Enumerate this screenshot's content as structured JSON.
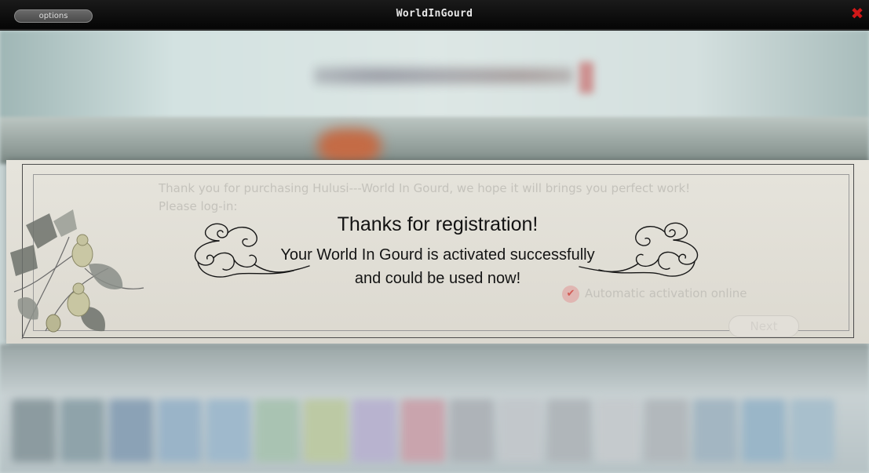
{
  "window": {
    "title": "WorldInGourd",
    "options_label": "options",
    "close_glyph": "✖"
  },
  "dialog": {
    "heading": "Thanks for registration!",
    "line1": "Your World In Gourd is activated successfully",
    "line2": "and could be used now!",
    "background_text": {
      "intro": "Thank you for purchasing Hulusi---World In Gourd, we hope it will brings you perfect work!",
      "login": "Please log-in:",
      "auto_activation": "Automatic activation online",
      "next_button": "Next"
    }
  },
  "icons": {
    "close": "close-icon",
    "cloud_left": "cloud-ornament-icon",
    "cloud_right": "cloud-ornament-icon",
    "gourd": "gourd-plant-icon",
    "check": "check-icon"
  },
  "colors": {
    "close": "#d01818",
    "dialog_bg": "#e3e1d9",
    "text": "#141414"
  }
}
